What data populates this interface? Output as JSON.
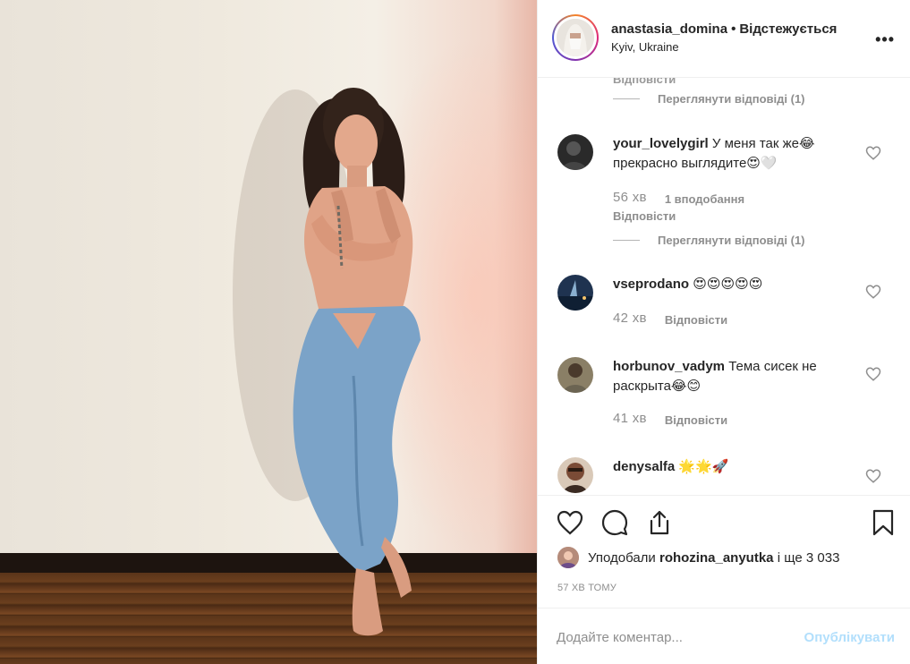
{
  "post": {
    "image_alt": "",
    "author": {
      "username": "anastasia_domina",
      "follow_status": "Відстежується",
      "location": "Kyiv, Ukraine"
    },
    "comments_partial_label": "Відповісти",
    "view_replies_top": "Переглянути відповіді (1)",
    "comments": [
      {
        "username": "your_lovelygirl",
        "text": "У меня так же😂 прекрасно выглядите😍🤍",
        "time": "56 хв",
        "likes_label": "1 вподобання",
        "reply_label": "Відповісти",
        "view_replies": "Переглянути відповіді (1)"
      },
      {
        "username": "vseprodano",
        "text": "😍😍😍😍😍",
        "time": "42 хв",
        "reply_label": "Відповісти"
      },
      {
        "username": "horbunov_vadym",
        "text": "Тема сисек не раскрыта😂😊",
        "time": "41 хв",
        "reply_label": "Відповісти"
      },
      {
        "username": "denysalfa",
        "text": "🌟🌟🚀"
      }
    ],
    "likes": {
      "prefix": "Уподобали",
      "user": "rohozina_anyutka",
      "suffix": "і ще 3 033"
    },
    "posted_ago": "57 ХВ ТОМУ",
    "add_comment_placeholder": "Додайте коментар...",
    "publish_label": "Опублікувати"
  },
  "icons": [
    "more-icon",
    "heart-icon",
    "comment-icon",
    "share-icon",
    "bookmark-icon"
  ],
  "colors": {
    "accent_disabled": "#b2dffc",
    "muted": "#8e8e8e",
    "text": "#262626",
    "border": "#efefef"
  }
}
